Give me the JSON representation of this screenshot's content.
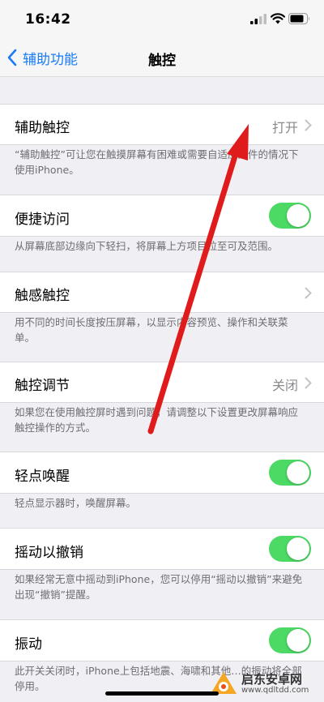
{
  "status_bar": {
    "time": "16:42"
  },
  "nav": {
    "back_label": "辅助功能",
    "title": "触控"
  },
  "rows": {
    "assistive_touch": {
      "label": "辅助触控",
      "value": "打开"
    },
    "reachability": {
      "label": "便捷访问"
    },
    "haptic_touch": {
      "label": "触感触控"
    },
    "touch_accommodations": {
      "label": "触控调节",
      "value": "关闭"
    },
    "tap_to_wake": {
      "label": "轻点唤醒"
    },
    "shake_to_undo": {
      "label": "摇动以撤销"
    },
    "vibration": {
      "label": "振动"
    }
  },
  "footers": {
    "assistive_touch": "“辅助触控”可让您在触摸屏幕有困难或需要自适应配件的情况下使用iPhone。",
    "reachability": "从屏幕底部边缘向下轻扫，将屏幕上方项目拉至可及范围。",
    "haptic_touch": "用不同的时间长度按压屏幕，以显示内容预览、操作和关联菜单。",
    "touch_accommodations": "如果您在使用触控屏时遇到问题，请调整以下设置更改屏幕响应触控操作的方式。",
    "tap_to_wake": "轻点显示器时，唤醒屏幕。",
    "shake_to_undo": "如果经常无意中摇动到iPhone，您可以停用“摇动以撤销”来避免出现“撤销”提醒。",
    "vibration": "此开关关闭时，iPhone上包括地震、海啸和其他…的振动将全部停用。"
  },
  "toggles": {
    "reachability": true,
    "tap_to_wake": true,
    "shake_to_undo": true,
    "vibration": true
  },
  "watermark": {
    "name": "启东安卓网",
    "url": "www.qdltdd.com"
  },
  "colors": {
    "accent": "#1a7cf5",
    "toggle_on": "#4cd964",
    "annotation_arrow": "#e01b1b"
  }
}
